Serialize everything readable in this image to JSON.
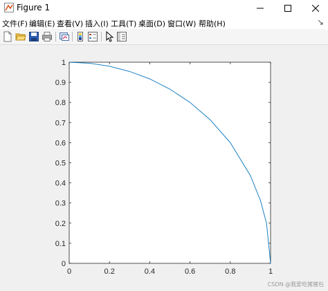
{
  "window": {
    "title": "Figure 1"
  },
  "menu": {
    "items": [
      "文件(F)",
      "编辑(E)",
      "查看(V)",
      "插入(I)",
      "工具(T)",
      "桌面(D)",
      "窗口(W)",
      "帮助(H)"
    ]
  },
  "toolbar": {
    "icons": [
      "new-figure-icon",
      "open-file-icon",
      "save-icon",
      "print-icon",
      "link-plot-icon",
      "insert-colorbar-icon",
      "insert-legend-icon",
      "edit-plot-arrow-icon",
      "property-inspector-icon"
    ]
  },
  "chart_data": {
    "type": "line",
    "title": "",
    "xlabel": "",
    "ylabel": "",
    "xlim": [
      0,
      1
    ],
    "ylim": [
      0,
      1
    ],
    "x_ticks": [
      "0",
      "0.2",
      "0.4",
      "0.6",
      "0.8",
      "1"
    ],
    "y_ticks": [
      "0",
      "0.1",
      "0.2",
      "0.3",
      "0.4",
      "0.5",
      "0.6",
      "0.7",
      "0.8",
      "0.9",
      "1"
    ],
    "grid": false,
    "series": [
      {
        "color": "#0072bd",
        "x": [
          0,
          0.1,
          0.2,
          0.3,
          0.4,
          0.5,
          0.6,
          0.7,
          0.8,
          0.9,
          0.95,
          0.98,
          1
        ],
        "y": [
          1,
          0.995,
          0.98,
          0.954,
          0.917,
          0.866,
          0.8,
          0.714,
          0.6,
          0.436,
          0.312,
          0.199,
          0
        ]
      }
    ]
  },
  "watermark": "CSDN @我爱吃猪猪包"
}
